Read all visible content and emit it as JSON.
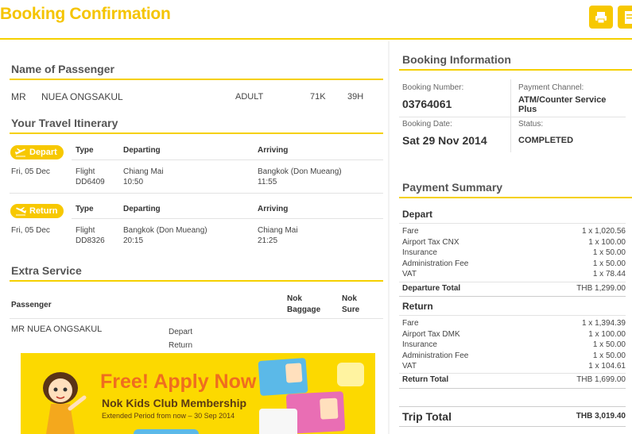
{
  "header": {
    "title": "Booking Confirmation"
  },
  "passenger_section": {
    "title": "Name of Passenger",
    "title_prefix": "MR",
    "name": "NUEA ONGSAKUL",
    "type": "ADULT",
    "seat1": "71K",
    "seat2": "39H"
  },
  "itinerary": {
    "title": "Your Travel Itinerary",
    "col_type": "Type",
    "col_departing": "Departing",
    "col_arriving": "Arriving",
    "depart": {
      "badge": "Depart",
      "date": "Fri, 05 Dec",
      "type": "Flight",
      "flight_no": "DD6409",
      "from": "Chiang Mai",
      "dep_time": "10:50",
      "to": "Bangkok (Don Mueang)",
      "arr_time": "11:55"
    },
    "return": {
      "badge": "Return",
      "date": "Fri, 05 Dec",
      "type": "Flight",
      "flight_no": "DD8326",
      "from": "Bangkok (Don Mueang)",
      "dep_time": "20:15",
      "to": "Chiang Mai",
      "arr_time": "21:25"
    }
  },
  "extra": {
    "title": "Extra Service",
    "col_passenger": "Passenger",
    "col_baggage_1": "Nok",
    "col_baggage_2": "Baggage",
    "col_sure_1": "Nok",
    "col_sure_2": "Sure",
    "passenger": "MR NUEA ONGSAKUL",
    "leg1": "Depart",
    "leg2": "Return"
  },
  "banner": {
    "headline": "Free! Apply Now",
    "subline": "Nok Kids Club Membership",
    "period": "Extended Period from now – 30 Sep 2014"
  },
  "booking_info": {
    "title": "Booking Information",
    "number_label": "Booking Number:",
    "number": "03764061",
    "channel_label": "Payment Channel:",
    "channel_1": "ATM/Counter Service",
    "channel_2": "Plus",
    "date_label": "Booking Date:",
    "date": "Sat 29 Nov 2014",
    "status_label": "Status:",
    "status": "COMPLETED"
  },
  "payment": {
    "title": "Payment Summary",
    "depart": {
      "heading": "Depart",
      "items": [
        {
          "label": "Fare",
          "value": "1 x 1,020.56"
        },
        {
          "label": "Airport Tax CNX",
          "value": "1 x 100.00"
        },
        {
          "label": "Insurance",
          "value": "1 x 50.00"
        },
        {
          "label": "Administration Fee",
          "value": "1 x 50.00"
        },
        {
          "label": "VAT",
          "value": "1 x 78.44"
        }
      ],
      "total_label": "Departure Total",
      "total_value": "THB  1,299.00"
    },
    "return": {
      "heading": "Return",
      "items": [
        {
          "label": "Fare",
          "value": "1 x 1,394.39"
        },
        {
          "label": "Airport Tax DMK",
          "value": "1 x 100.00"
        },
        {
          "label": "Insurance",
          "value": "1 x 50.00"
        },
        {
          "label": "Administration Fee",
          "value": "1 x 50.00"
        },
        {
          "label": "VAT",
          "value": "1 x 104.61"
        }
      ],
      "total_label": "Return Total",
      "total_value": "THB  1,699.00"
    },
    "trip_total_label": "Trip Total",
    "trip_total_value": "THB 3,019.40"
  },
  "colors": {
    "accent": "#f7c800",
    "heading": "#f5c400",
    "banner_bg": "#fcd900",
    "banner_text": "#ef6d1f"
  },
  "icons": [
    "print-icon",
    "pdf-icon",
    "plane-depart-icon",
    "plane-return-icon"
  ]
}
